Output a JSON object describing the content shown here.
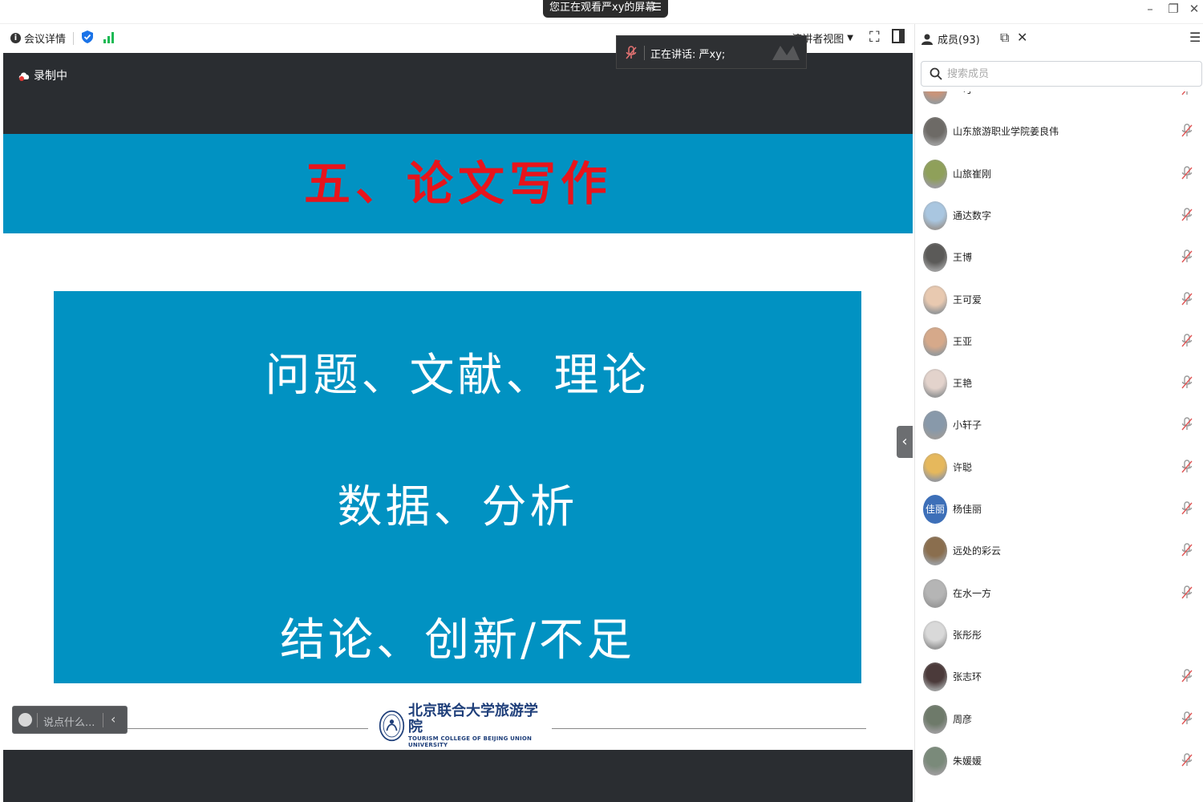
{
  "title_bar": {
    "share_banner": "您正在观看严xy的屏幕"
  },
  "toolbar": {
    "meeting_details": "会议详情",
    "view_mode": "演讲者视图"
  },
  "speaking": {
    "label": "正在讲话: 严xy;"
  },
  "stage": {
    "recording": "录制中"
  },
  "slide": {
    "title": "五、论文写作",
    "lines": [
      "问题、文献、理论",
      "数据、分析",
      "结论、创新/不足"
    ],
    "footer_cn": "北京联合大学旅游学院",
    "footer_en": "TOURISM COLLEGE OF BEIJING UNION UNIVERSITY"
  },
  "chat": {
    "placeholder": "说点什么..."
  },
  "panel": {
    "members_label": "成员(93)",
    "search_placeholder": "搜索成员"
  },
  "members": [
    {
      "name": "一可",
      "muted": true
    },
    {
      "name": "山东旅游职业学院姜良伟",
      "muted": true
    },
    {
      "name": "山旅崔刚",
      "muted": true
    },
    {
      "name": "通达数字",
      "muted": true
    },
    {
      "name": "王博",
      "muted": true
    },
    {
      "name": "王可爱",
      "muted": true
    },
    {
      "name": "王亚",
      "muted": true
    },
    {
      "name": "王艳",
      "muted": true
    },
    {
      "name": "小轩子",
      "muted": true
    },
    {
      "name": "许聪",
      "muted": true
    },
    {
      "name": "杨佳丽",
      "muted": true,
      "avatar_text": "佳丽"
    },
    {
      "name": "远处的彩云",
      "muted": true
    },
    {
      "name": "在水一方",
      "muted": true
    },
    {
      "name": "张彤彤",
      "muted": false
    },
    {
      "name": "张志环",
      "muted": true
    },
    {
      "name": "周彦",
      "muted": true
    },
    {
      "name": "朱媛媛",
      "muted": true
    }
  ],
  "colors": {
    "slide_blue": "#0192c2",
    "title_red": "#e8141b",
    "stage_dark": "#2a2d31",
    "signal_green": "#1db954",
    "shield_blue": "#1a73e8"
  }
}
